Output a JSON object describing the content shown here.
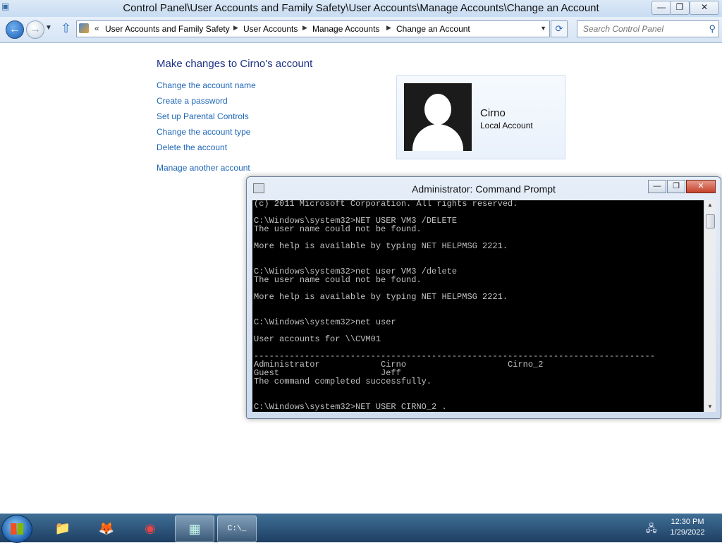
{
  "explorer": {
    "title": "Control Panel\\User Accounts and Family Safety\\User Accounts\\Manage Accounts\\Change an Account",
    "window_buttons": {
      "minimize": "—",
      "restore": "❐",
      "close": "✕"
    },
    "breadcrumb": {
      "overflow": "«",
      "items": [
        "User Accounts and Family Safety",
        "User Accounts",
        "Manage Accounts",
        "Change an Account"
      ]
    },
    "search_placeholder": "Search Control Panel"
  },
  "control_panel": {
    "heading": "Make changes to Cirno's account",
    "tasks": [
      "Change the account name",
      "Create a password",
      "Set up Parental Controls",
      "Change the account type",
      "Delete the account"
    ],
    "manage_another": "Manage another account",
    "account": {
      "name": "Cirno",
      "type": "Local Account"
    }
  },
  "cmd": {
    "title": "Administrator: Command Prompt",
    "lines": [
      "(c) 2011 Microsoft Corporation. All rights reserved.",
      "",
      "C:\\Windows\\system32>NET USER VM3 /DELETE",
      "The user name could not be found.",
      "",
      "More help is available by typing NET HELPMSG 2221.",
      "",
      "",
      "C:\\Windows\\system32>net user VM3 /delete",
      "The user name could not be found.",
      "",
      "More help is available by typing NET HELPMSG 2221.",
      "",
      "",
      "C:\\Windows\\system32>net user",
      "",
      "User accounts for \\\\CVM01",
      "",
      "-------------------------------------------------------------------------------",
      "Administrator            Cirno                    Cirno_2",
      "Guest                    Jeff",
      "The command completed successfully.",
      "",
      "",
      "C:\\Windows\\system32>NET USER CIRNO_2 ."
    ]
  },
  "taskbar": {
    "items": [
      {
        "name": "explorer",
        "glyph": "📁"
      },
      {
        "name": "firefox",
        "glyph": "🦊"
      },
      {
        "name": "chrome",
        "glyph": "◉"
      },
      {
        "name": "control-panel",
        "glyph": "▦"
      },
      {
        "name": "command-prompt",
        "glyph": "C:\\_"
      }
    ],
    "clock": {
      "time": "12:30 PM",
      "date": "1/29/2022"
    }
  },
  "colors": {
    "link": "#1e66b8",
    "heading": "#1e3287",
    "console_bg": "#000000",
    "console_fg": "#c0c0c0"
  }
}
